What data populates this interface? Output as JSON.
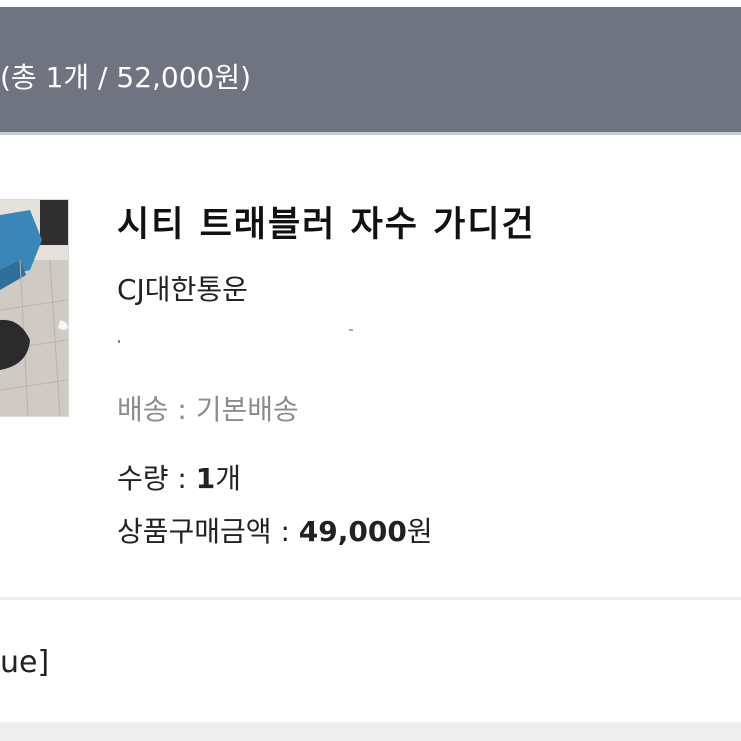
{
  "order": {
    "summary": "(총 1개 / 52,000원)"
  },
  "product": {
    "name": "시티 트래블러 자수 가디건",
    "carrier": "CJ대한통운",
    "shipping_label": "배송 : 기본배송",
    "quantity_label": "수량 : ",
    "quantity_value": "1",
    "quantity_unit": "개",
    "amount_label": "상품구매금액 : ",
    "amount_value": "49,000",
    "amount_unit": "원"
  },
  "option": {
    "text": "ue]"
  },
  "colors": {
    "header_bg": "#707480",
    "header_text": "#ffffff",
    "muted_text": "#8c8c8c"
  },
  "icons": {
    "thumbnail": "product-photo"
  }
}
